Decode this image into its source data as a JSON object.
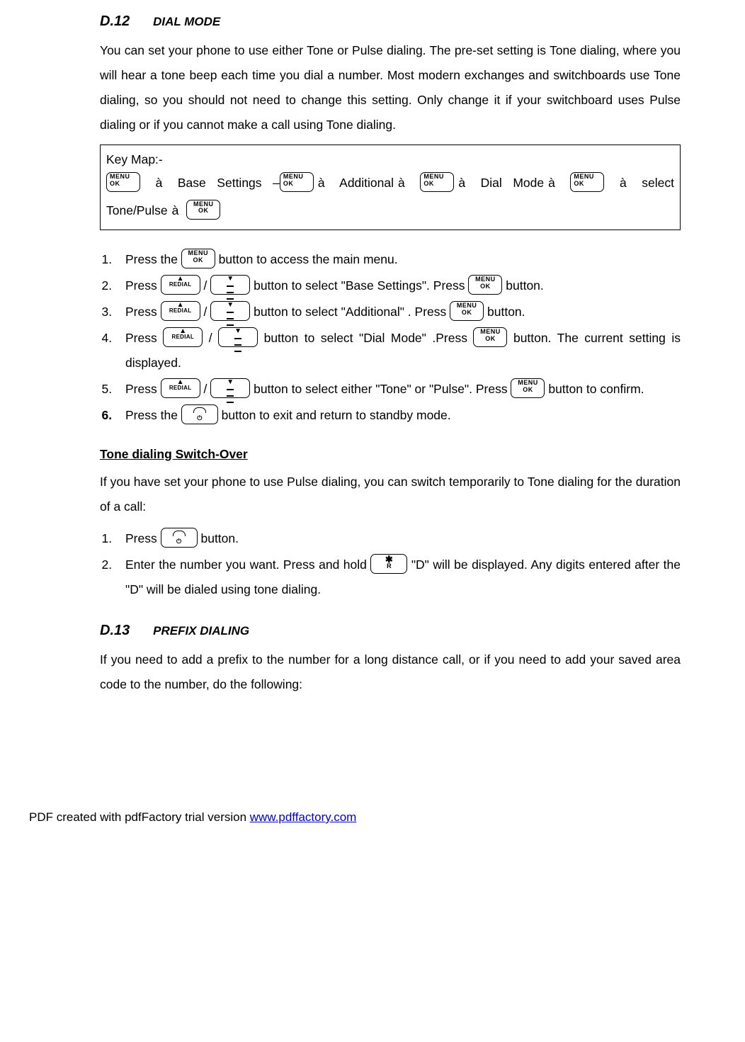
{
  "section_d12": {
    "num": "D.12",
    "title": "DIAL MODE",
    "intro": "You can set your phone to use either Tone or Pulse dialing. The pre-set setting is Tone dialing, where you will hear a tone beep each time you dial a number. Most modern exchanges and switchboards use Tone dialing, so you should not need to change this setting. Only change it if your switchboard uses Pulse dialing or if you cannot make a call using Tone dialing."
  },
  "keymap": {
    "label": "Key Map:-",
    "arrow": "à",
    "items": {
      "base_settings": "Base Settings",
      "additional": "Additional",
      "dial_mode": "Dial Mode",
      "select_tp": "select Tone/Pulse",
      "dash": "–"
    }
  },
  "buttons": {
    "menu_l1": "MENU",
    "menu_l2": "OK",
    "redial_txt": "REDIAL",
    "up_arrow": "▲",
    "down_arrow": "▼",
    "power": "⏻",
    "star": "✱",
    "R": "R"
  },
  "steps_d12": {
    "s1a": "Press the ",
    "s1b": " button to access the main menu.",
    "s2a": "Press ",
    "s2b": " / ",
    "s2c": " button to select \"Base Settings\". Press ",
    "s2d": " button.",
    "s3a": "Press ",
    "s3b": " / ",
    "s3c": " button to select \"Additional\" . Press ",
    "s3d": " button.",
    "s4a": "Press ",
    "s4b": " / ",
    "s4c": " button to select \"Dial Mode\" .Press ",
    "s4d": " button. The current setting is displayed.",
    "s5a": "Press ",
    "s5b": " / ",
    "s5c": " button to select either \"Tone\" or \"Pulse\". Press ",
    "s5d": " button to confirm.",
    "s6a": "Press the ",
    "s6b": " button to exit and return to standby mode."
  },
  "tone_switch": {
    "heading": "Tone dialing Switch-Over",
    "intro": "If you have set your phone to use Pulse dialing, you can switch temporarily to Tone dialing for the duration of a call:",
    "s1a": "Press ",
    "s1b": " button.",
    "s2a": "Enter the number you want. Press and hold ",
    "s2b": " \"D\" will be displayed. Any digits entered after the \"D\" will be dialed using tone dialing."
  },
  "section_d13": {
    "num": "D.13",
    "title": "PREFIX DIALING",
    "intro": "If you need to add a prefix to the number for a long distance call, or if you need to add your saved area code to the number, do the following:"
  },
  "footer": {
    "text": "PDF created with pdfFactory trial version ",
    "link": "www.pdffactory.com"
  }
}
